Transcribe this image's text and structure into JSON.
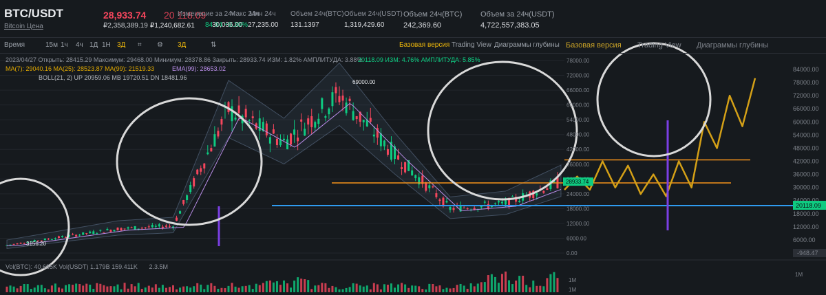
{
  "header": {
    "pair": "BTC/USDT",
    "subtitle": "Bitcoin Цена",
    "last_price": "28,933.74",
    "last_price_rub": "₽2,358,389.19",
    "change": "20 118.09",
    "change_rub": "₽1,240,682.61",
    "stats": [
      {
        "label": "Изменение за 24ч",
        "value": "84.84 +0.30%"
      },
      {
        "label": "Макс 24ч",
        "value": "30,036.00"
      },
      {
        "label": "Мин 24ч",
        "value": "27,235.00"
      },
      {
        "label": "Объем 24ч(BTC)",
        "value": "131.1397"
      },
      {
        "label": "Объем 24ч(USDT)",
        "value": "1,319,429.60"
      },
      {
        "label": "Объем 24ч(BTC)",
        "value": "242,369.60"
      },
      {
        "label": "Объем за 24ч(USDT)",
        "value": "4,722,557,383.05"
      }
    ]
  },
  "toolbar": {
    "items": [
      "Время",
      "15м",
      "1ч",
      "4ч",
      "1Д",
      "1Н",
      "3Д"
    ],
    "active": "3Д",
    "tabs": [
      "Базовая версия",
      "Trading View",
      "Диаграммы глубины"
    ],
    "tabs2": [
      "Базовая версия",
      "Trading View",
      "Диаграммы глубины"
    ]
  },
  "indicators": {
    "ohlc": "2023/04/27 Открыть: 28415.29 Максимум: 29468.00 Минимум: 28378.86 Закрыть: 28933.74 ИЗМ: 1.82% АМПЛИТУДА: 3.88%",
    "ohlc2": "20118.09 ИЗМ: 4.76% АМПЛИТУДА: 5.85%",
    "ma": "MA(7): 29040.16 MA(25): 28523.87 MA(99): 21519.33",
    "ema": "EMA(99): 28653.02",
    "boll": "BOLL(21, 2) UP 20959.06 MB 19720.51 DN 18481.96",
    "vol": "Vol(BTC): 40.685K Vol(USDT) 1.179B 159.411K",
    "vol_extra": "2.3.5M"
  },
  "markers": {
    "high_label": "69000.00",
    "low_label": "3156.20",
    "current_price": "28933.74",
    "support_price": "20118.09",
    "neg_label": "-948.47"
  },
  "colors": {
    "bg": "#161a1e",
    "up": "#0ecb81",
    "down": "#f6465d",
    "orange": "#f7931a",
    "gold": "#d4a017",
    "blue": "#2f9bf0",
    "purple": "#7b3fe4",
    "circle": "#d9d9d9"
  },
  "chart_data": {
    "type": "line",
    "x": [
      0,
      10,
      20,
      30,
      40,
      50,
      60,
      70,
      80,
      90,
      100
    ],
    "series": [
      {
        "values": [
          3200,
          6500,
          9800,
          11000,
          58000,
          45000,
          64000,
          40000,
          18000,
          20000,
          28933
        ]
      }
    ],
    "y_axis_inner": [
      "78000.00",
      "72000.00",
      "66000.00",
      "60000.00",
      "54000.00",
      "48000.00",
      "42000.00",
      "36000.00",
      "30000.00",
      "24000.00",
      "18000.00",
      "12000.00",
      "6000.00",
      "0.00"
    ],
    "y_axis_outer": [
      "84000.00",
      "78000.00",
      "72000.00",
      "66000.00",
      "60000.00",
      "54000.00",
      "48000.00",
      "42000.00",
      "36000.00",
      "30000.00",
      "24000.00",
      "18000.00",
      "12000.00",
      "6000.00",
      "0.00"
    ],
    "vol_axis": [
      "1M",
      "1M",
      "1M"
    ],
    "resistance_upper": 42000,
    "resistance_mid": 29000,
    "support": 20118.09,
    "forecast_path": [
      28933,
      35000,
      29000,
      42000,
      30000,
      40000,
      27000,
      36000,
      26000,
      42000,
      30000,
      60000,
      48000,
      72000,
      58000,
      80000
    ]
  }
}
